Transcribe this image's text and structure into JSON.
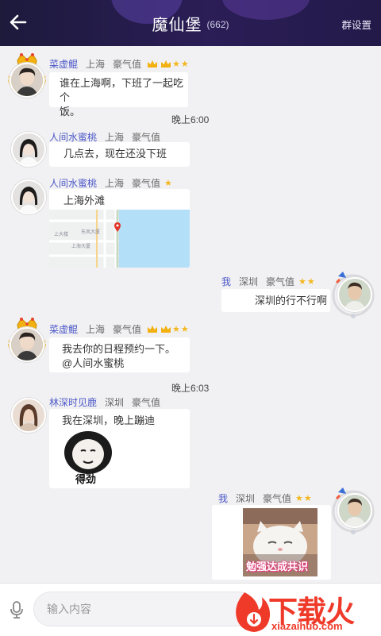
{
  "header": {
    "title": "魔仙堡",
    "member_count": "(662)",
    "settings_label": "群设置",
    "colors": {
      "bg_start": "#1d1a3c",
      "bg_end": "#2b1d56"
    }
  },
  "messages": [
    {
      "id": "m1",
      "side": "left",
      "name": "菜虚鲲",
      "city": "上海",
      "wealth_label": "豪气值",
      "crowns": 2,
      "stars": 2,
      "text_lines": [
        "谁在上海啊，下班了一起吃个",
        "饭。"
      ]
    },
    {
      "id": "t1",
      "type": "time",
      "text": "晚上6:00"
    },
    {
      "id": "m2",
      "side": "left",
      "name": "人间水蜜桃",
      "city": "上海",
      "wealth_label": "豪气值",
      "crowns": 0,
      "stars": 0,
      "text_lines": [
        "几点去，现在还没下班"
      ]
    },
    {
      "id": "m3",
      "side": "left",
      "name": "人间水蜜桃",
      "city": "上海",
      "wealth_label": "豪气值",
      "stars": 1,
      "text_lines": [
        "上海外滩"
      ],
      "map_labels": [
        "东风大厦",
        "上海大厦"
      ]
    },
    {
      "id": "m4",
      "side": "right",
      "name": "我",
      "city": "深圳",
      "wealth_label": "豪气值",
      "stars": 2,
      "text_lines": [
        "深圳的行不行啊"
      ]
    },
    {
      "id": "m5",
      "side": "left",
      "name": "菜虚鲲",
      "city": "上海",
      "wealth_label": "豪气值",
      "crowns": 2,
      "stars": 2,
      "text_lines": [
        "我去你的日程预约一下。",
        "@人间水蜜桃"
      ]
    },
    {
      "id": "t2",
      "type": "time",
      "text": "晚上6:03"
    },
    {
      "id": "m6",
      "side": "left",
      "name": "林深时见鹿",
      "city": "深圳",
      "wealth_label": "豪气值",
      "stars": 0,
      "text_lines": [
        "我在深圳，晚上蹦迪"
      ],
      "sticker_caption": "得劲"
    },
    {
      "id": "m7",
      "side": "right",
      "name": "我",
      "city": "深圳",
      "wealth_label": "豪气值",
      "stars": 2,
      "image_caption": "勉强达成共识"
    }
  ],
  "input": {
    "placeholder": "输入内容"
  },
  "watermark": {
    "text": "下载火",
    "url": "xiazaihuo.com"
  },
  "colors": {
    "name": "#4d58c8",
    "star": "#f3b81f",
    "crown": "#f2b111",
    "background": "#f1f1f3"
  }
}
